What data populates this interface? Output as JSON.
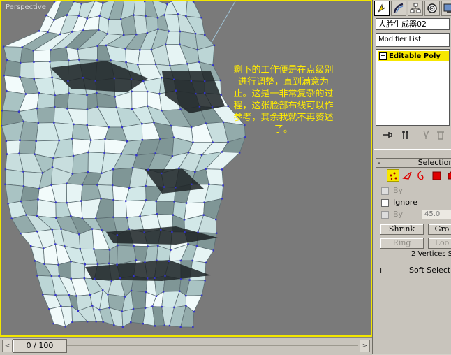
{
  "viewport": {
    "label": "Perspective",
    "annotation": "剩下的工作便是在点级别进行调整，直到满意为止。这是一非常复杂的过程，这张脸部布线可以作参考，其余我就不再赘述了。"
  },
  "timeslider": {
    "frame_text": "0 / 100",
    "prev_glyph": "<",
    "next_glyph": ">"
  },
  "command_panel": {
    "tabs": [
      {
        "icon": "create-icon",
        "active": true
      },
      {
        "icon": "modify-icon",
        "active": false
      },
      {
        "icon": "hierarchy-icon",
        "active": false
      },
      {
        "icon": "motion-icon",
        "active": false
      },
      {
        "icon": "display-icon",
        "active": false
      }
    ],
    "object_name": "人脸生成器02",
    "modifier_list": "Modifier List",
    "stack_item": "Editable Poly",
    "stack_expand": "+",
    "selection": {
      "sign": "-",
      "title": "Selection",
      "by_vertex_label": "By",
      "ignore_label": "Ignore",
      "by_angle_label": "By",
      "angle_value": "45.0",
      "shrink": "Shrink",
      "grow": "Gro",
      "ring": "Ring",
      "loop": "Loo",
      "status": "2 Vertices Sele"
    },
    "soft_selection": {
      "sign": "+",
      "title": "Soft Selection"
    }
  },
  "colors": {
    "viewport_border": "#f2e600",
    "annotation": "#ffeb00",
    "mesh_fill": "#d6ecec",
    "vertex": "#3333cc",
    "stack_highlight": "#f7e700"
  }
}
